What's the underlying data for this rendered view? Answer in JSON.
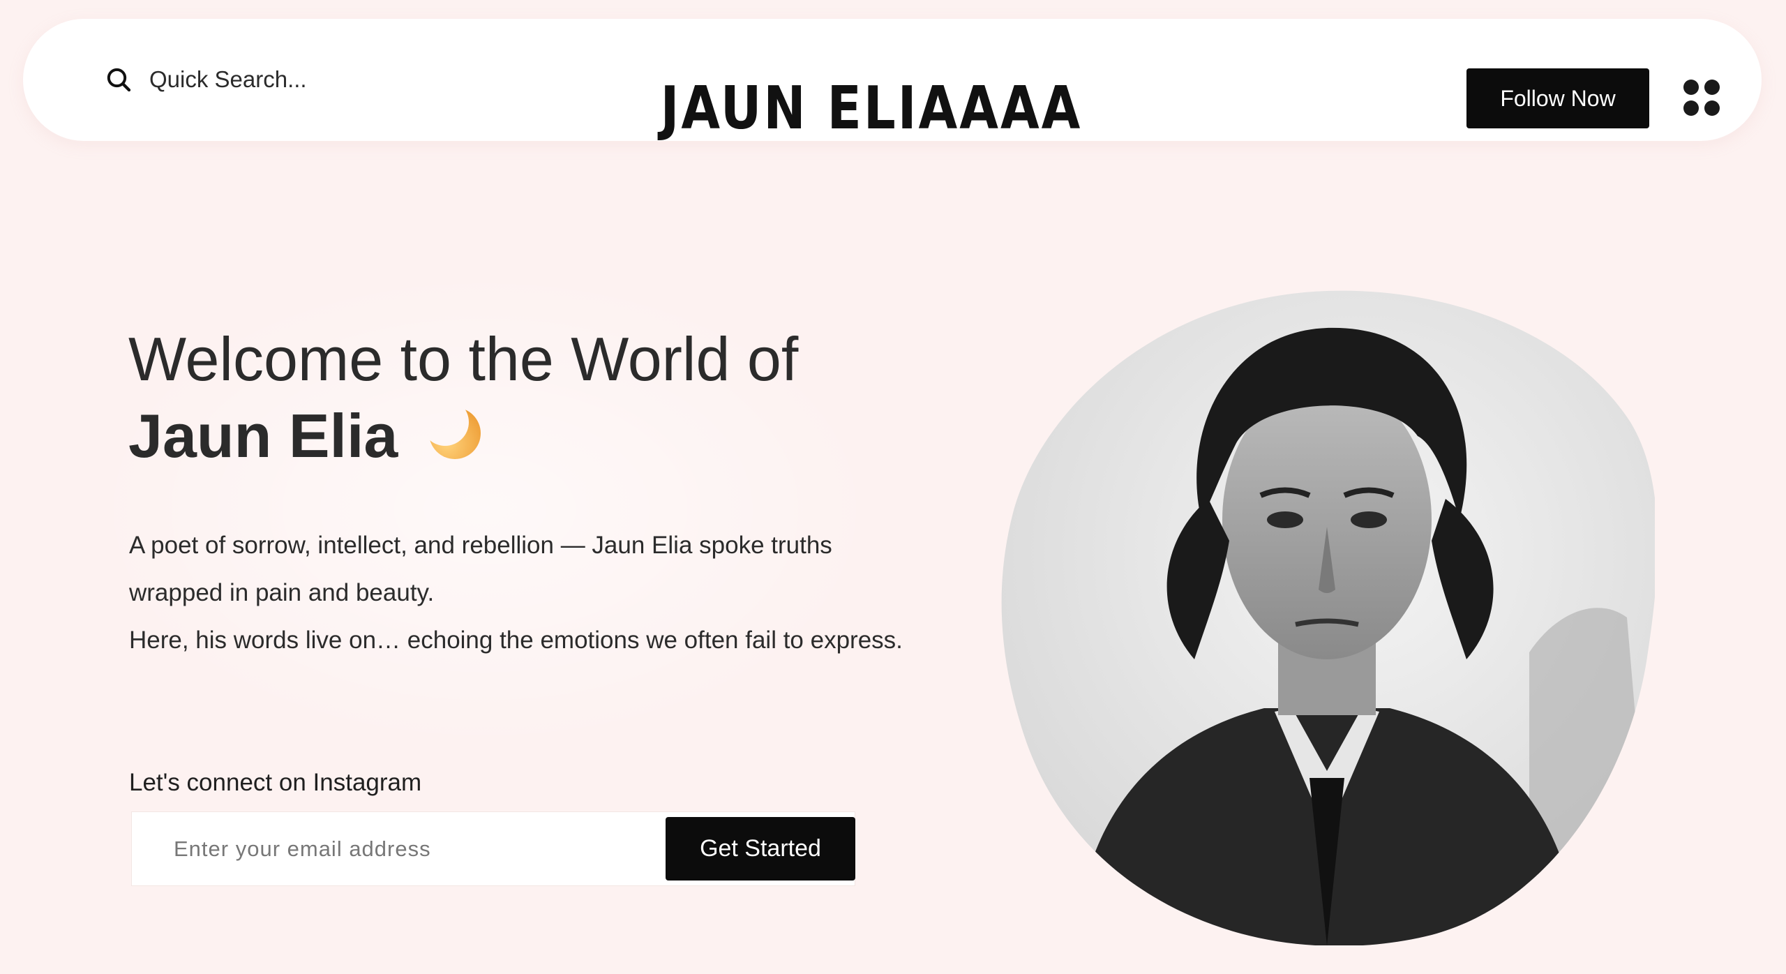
{
  "header": {
    "search_label": "Quick Search...",
    "logo_text": "JAUN ELIAAAA",
    "follow_label": "Follow Now"
  },
  "hero": {
    "headline_line1": "Welcome to the World of",
    "headline_name": "Jaun Elia",
    "headline_emoji": "crescent-moon",
    "description_1": "A poet of sorrow, intellect, and rebellion — Jaun Elia spoke truths wrapped in pain and beauty.",
    "description_2": "Here, his words live on… echoing the emotions we often fail to express.",
    "connect_label": "Let's connect on Instagram",
    "email_placeholder": "Enter your email address",
    "cta_label": "Get Started"
  },
  "colors": {
    "page_bg": "#fdf2f1",
    "button_bg": "#0c0c0c",
    "moon": "#f5b04a"
  }
}
